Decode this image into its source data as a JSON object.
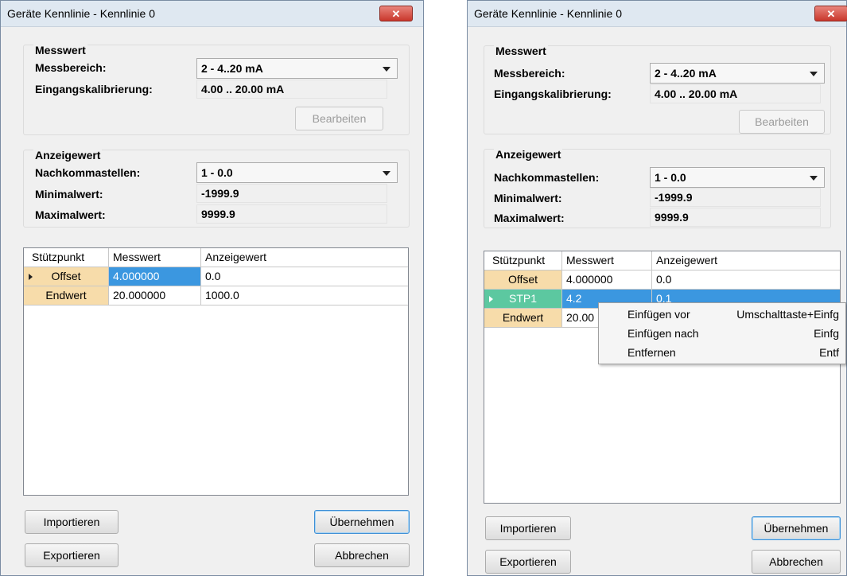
{
  "left": {
    "title": "Geräte Kennlinie - Kennlinie 0",
    "close_glyph": "✕",
    "messwert": {
      "title": "Messwert",
      "messbereich_label": "Messbereich:",
      "messbereich_value": "2 - 4..20 mA",
      "eingang_label": "Eingangskalibrierung:",
      "eingang_value": "4.00 .. 20.00 mA",
      "bearbeiten_label": "Bearbeiten"
    },
    "anzeigewert": {
      "title": "Anzeigewert",
      "nachkomma_label": "Nachkommastellen:",
      "nachkomma_value": "1 - 0.0",
      "min_label": "Minimalwert:",
      "min_value": "-1999.9",
      "max_label": "Maximalwert:",
      "max_value": "9999.9"
    },
    "table": {
      "headers": [
        "Stützpunkt",
        "Messwert",
        "Anzeigewert"
      ],
      "rows": [
        {
          "point": "Offset",
          "messwert": "4.000000",
          "anzeige": "0.0"
        },
        {
          "point": "Endwert",
          "messwert": "20.000000",
          "anzeige": "1000.0"
        }
      ]
    },
    "buttons": {
      "importieren": "Importieren",
      "exportieren": "Exportieren",
      "uebernehmen": "Übernehmen",
      "abbrechen": "Abbrechen"
    }
  },
  "right": {
    "title": "Geräte Kennlinie - Kennlinie 0",
    "close_glyph": "✕",
    "messwert": {
      "title": "Messwert",
      "messbereich_label": "Messbereich:",
      "messbereich_value": "2 - 4..20 mA",
      "eingang_label": "Eingangskalibrierung:",
      "eingang_value": "4.00 .. 20.00 mA",
      "bearbeiten_label": "Bearbeiten"
    },
    "anzeigewert": {
      "title": "Anzeigewert",
      "nachkomma_label": "Nachkommastellen:",
      "nachkomma_value": "1 - 0.0",
      "min_label": "Minimalwert:",
      "min_value": "-1999.9",
      "max_label": "Maximalwert:",
      "max_value": "9999.9"
    },
    "table": {
      "headers": [
        "Stützpunkt",
        "Messwert",
        "Anzeigewert"
      ],
      "rows": [
        {
          "point": "Offset",
          "messwert": "4.000000",
          "anzeige": "0.0"
        },
        {
          "point": "STP1",
          "messwert": "4.2",
          "anzeige": "0.1"
        },
        {
          "point": "Endwert",
          "messwert": "20.00",
          "anzeige": ""
        }
      ]
    },
    "context_menu": [
      {
        "label": "Einfügen vor",
        "shortcut": "Umschalttaste+Einfg"
      },
      {
        "label": "Einfügen nach",
        "shortcut": "Einfg"
      },
      {
        "label": "Entfernen",
        "shortcut": "Entf"
      }
    ],
    "buttons": {
      "importieren": "Importieren",
      "exportieren": "Exportieren",
      "uebernehmen": "Übernehmen",
      "abbrechen": "Abbrechen"
    }
  },
  "colors": {
    "row_header": "#f7dcaa",
    "row_header_selected": "#5cc8a0",
    "cell_selected": "#3b97e0",
    "close_button": "#c9372c"
  }
}
